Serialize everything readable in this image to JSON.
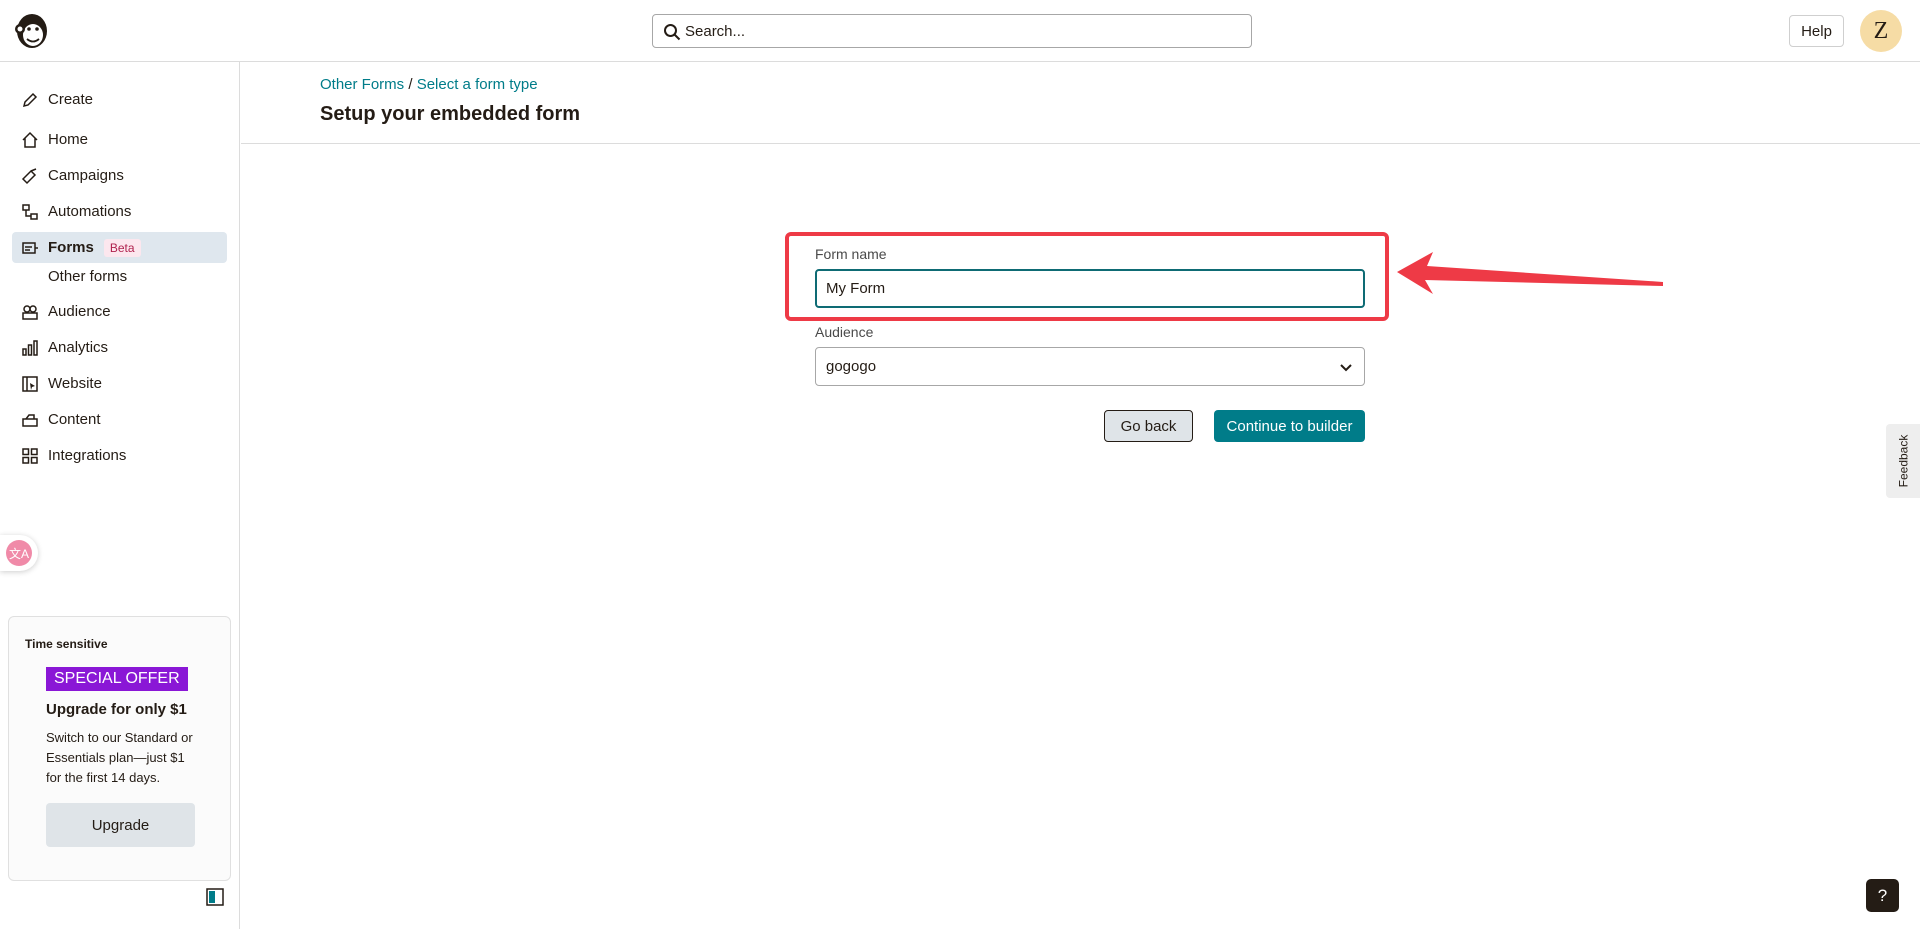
{
  "search": {
    "placeholder": "Search..."
  },
  "header": {
    "help_label": "Help",
    "avatar_initial": "Z"
  },
  "sidebar": {
    "items": [
      {
        "label": "Create",
        "icon": "pencil-icon"
      },
      {
        "label": "Home",
        "icon": "home-icon"
      },
      {
        "label": "Campaigns",
        "icon": "megaphone-icon"
      },
      {
        "label": "Automations",
        "icon": "automations-icon"
      },
      {
        "label": "Forms",
        "icon": "forms-icon",
        "badge": "Beta",
        "active": true
      },
      {
        "label": "Audience",
        "icon": "audience-icon"
      },
      {
        "label": "Analytics",
        "icon": "bar-chart-icon"
      },
      {
        "label": "Website",
        "icon": "website-icon"
      },
      {
        "label": "Content",
        "icon": "content-icon"
      },
      {
        "label": "Integrations",
        "icon": "grid-icon"
      }
    ],
    "sub_item": "Other forms",
    "promo": {
      "tag": "Time sensitive",
      "offer": "SPECIAL OFFER",
      "title": "Upgrade for only $1",
      "description": "Switch to our Standard or Essentials plan—just $1 for the first 14 days.",
      "button": "Upgrade"
    }
  },
  "breadcrumb": {
    "first": "Other Forms",
    "separator": "/",
    "second": "Select a form type"
  },
  "page": {
    "title": "Setup your embedded form"
  },
  "form": {
    "name_label": "Form name",
    "name_value": "My Form",
    "audience_label": "Audience",
    "audience_value": "gogogo",
    "back_label": "Go back",
    "continue_label": "Continue to builder"
  },
  "feedback_label": "Feedback",
  "help_fab": "?",
  "colors": {
    "accent": "#007c89",
    "highlight": "#ee3a46",
    "offer": "#8a17d6"
  }
}
